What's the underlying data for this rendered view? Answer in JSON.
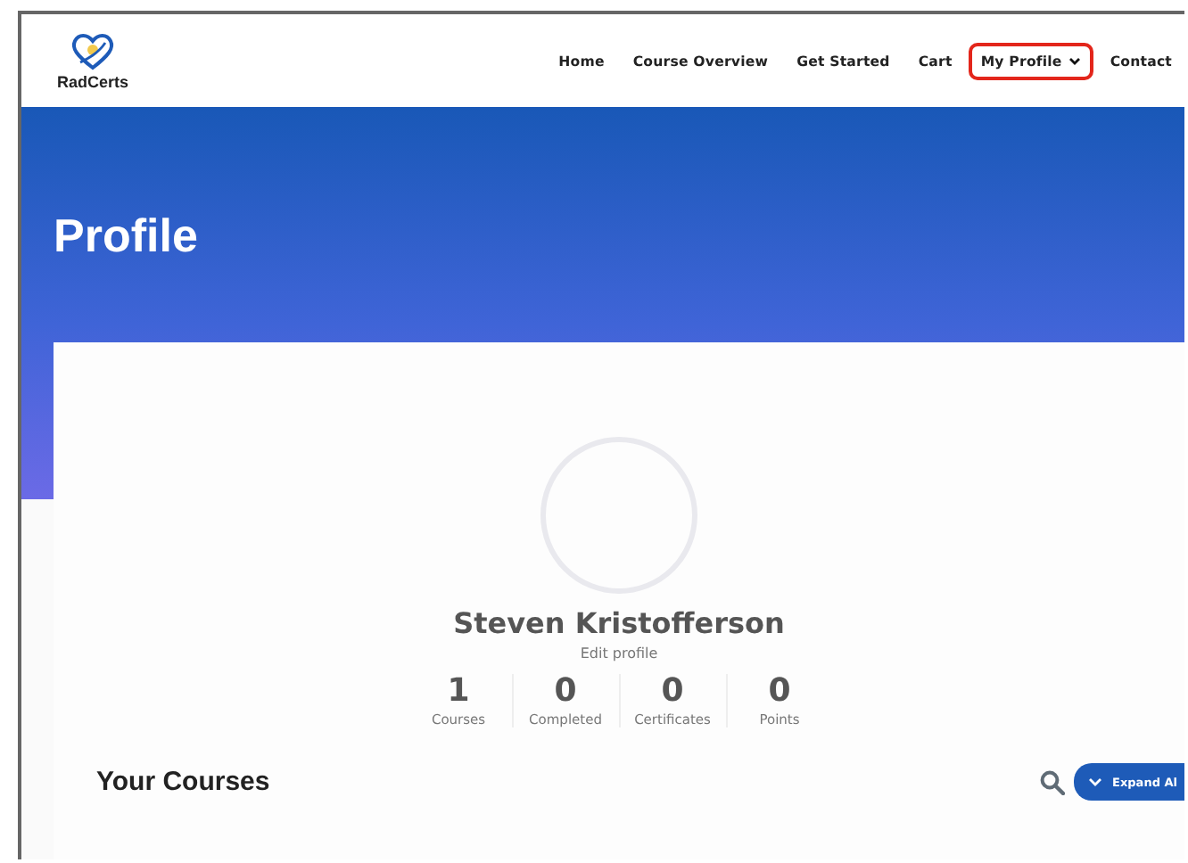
{
  "logo": {
    "text": "RadCerts"
  },
  "nav": [
    {
      "label": "Home",
      "highlighted": false,
      "dropdown": false
    },
    {
      "label": "Course Overview",
      "highlighted": false,
      "dropdown": false
    },
    {
      "label": "Get Started",
      "highlighted": false,
      "dropdown": false
    },
    {
      "label": "Cart",
      "highlighted": false,
      "dropdown": false
    },
    {
      "label": "My Profile",
      "highlighted": true,
      "dropdown": true
    },
    {
      "label": "Contact",
      "highlighted": false,
      "dropdown": false
    }
  ],
  "hero": {
    "title": "Profile"
  },
  "profile": {
    "name": "Steven Kristofferson",
    "edit_link": "Edit profile",
    "stats": [
      {
        "value": "1",
        "label": "Courses"
      },
      {
        "value": "0",
        "label": "Completed"
      },
      {
        "value": "0",
        "label": "Certificates"
      },
      {
        "value": "0",
        "label": "Points"
      }
    ]
  },
  "courses": {
    "heading": "Your Courses",
    "expand_button": "Expand Al"
  }
}
